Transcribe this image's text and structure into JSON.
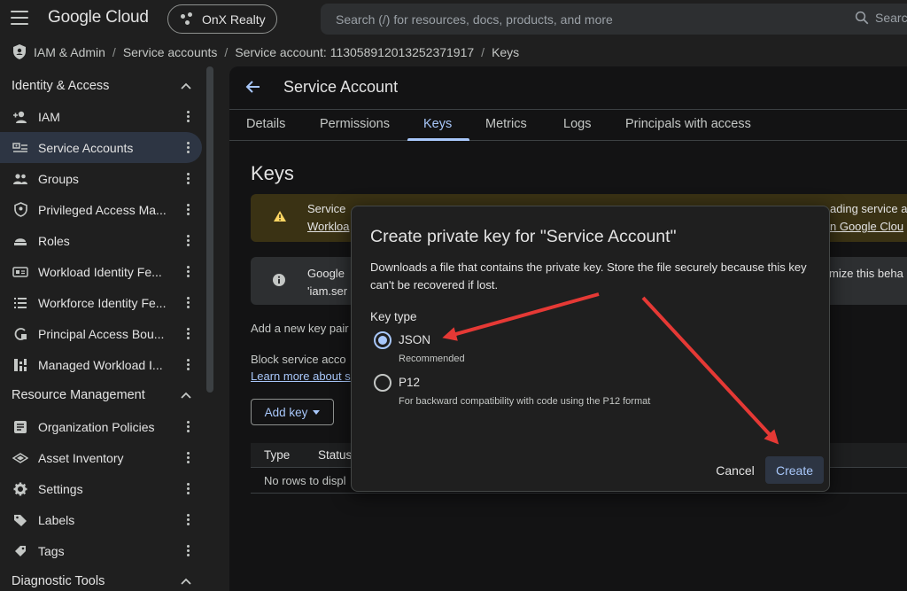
{
  "topbar": {
    "brand": "Google Cloud",
    "project": "OnX Realty",
    "search_placeholder": "Search (/) for resources, docs, products, and more",
    "search_button": "Searc"
  },
  "breadcrumb": [
    "IAM & Admin",
    "Service accounts",
    "Service account: 113058912013252371917",
    "Keys"
  ],
  "sidebar": {
    "sections": [
      {
        "title": "Identity & Access"
      },
      {
        "title": "Resource Management"
      },
      {
        "title": "Diagnostic Tools"
      }
    ],
    "items": [
      {
        "label": "IAM",
        "icon": "person-add-icon"
      },
      {
        "label": "Service Accounts",
        "icon": "service-account-icon"
      },
      {
        "label": "Groups",
        "icon": "groups-icon"
      },
      {
        "label": "Privileged Access Ma...",
        "icon": "shield-icon"
      },
      {
        "label": "Roles",
        "icon": "roles-icon"
      },
      {
        "label": "Workload Identity Fe...",
        "icon": "id-card-icon"
      },
      {
        "label": "Workforce Identity Fe...",
        "icon": "list-icon"
      },
      {
        "label": "Principal Access Bou...",
        "icon": "boundary-icon"
      },
      {
        "label": "Managed Workload I...",
        "icon": "grid-icon"
      },
      {
        "label": "Organization Policies",
        "icon": "policy-icon"
      },
      {
        "label": "Asset Inventory",
        "icon": "asset-icon"
      },
      {
        "label": "Settings",
        "icon": "gear-icon"
      },
      {
        "label": "Labels",
        "icon": "label-icon"
      },
      {
        "label": "Tags",
        "icon": "tag-icon"
      }
    ]
  },
  "panel": {
    "title": "Service Account",
    "tabs": [
      "Details",
      "Permissions",
      "Keys",
      "Metrics",
      "Logs",
      "Principals with access"
    ],
    "active_tab": "Keys",
    "heading": "Keys",
    "warning_line1_start": "Service",
    "warning_line1_end": "ading service a",
    "warning_line2_start": "Workloa",
    "warning_line2_end": "n Google Clou",
    "info_line1_start": "Google",
    "info_line1_end": "mize this beha",
    "info_line2_start": "'iam.ser",
    "add_key_text": "Add a new key pair",
    "block_text": "Block service acco",
    "learn_more": "Learn more about s",
    "add_key_button": "Add key",
    "table_headers": [
      "Type",
      "Status"
    ],
    "empty_text": "No rows to displ"
  },
  "dialog": {
    "title": "Create private key for \"Service Account\"",
    "description": "Downloads a file that contains the private key. Store the file securely because this key can't be recovered if lost.",
    "key_type_label": "Key type",
    "options": [
      {
        "label": "JSON",
        "sub": "Recommended",
        "checked": true
      },
      {
        "label": "P12",
        "sub": "For backward compatibility with code using the P12 format",
        "checked": false
      }
    ],
    "cancel": "Cancel",
    "create": "Create"
  },
  "colors": {
    "accent": "#a8c7fa",
    "annotation_arrow": "#e53935",
    "warning_bg": "#3a3214",
    "warning_icon": "#fdd663"
  }
}
